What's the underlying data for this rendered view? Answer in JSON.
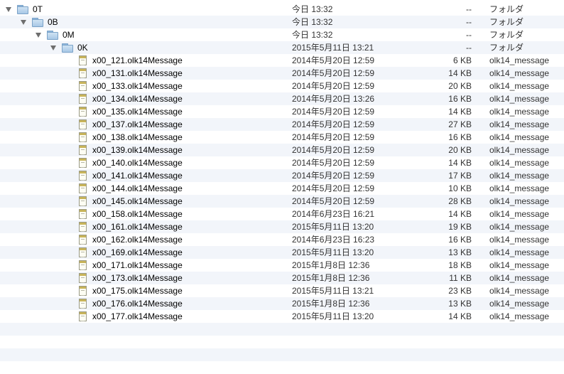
{
  "folders": [
    {
      "name": "0T",
      "date": "今日 13:32",
      "size": "--",
      "kind": "フォルダ"
    },
    {
      "name": "0B",
      "date": "今日 13:32",
      "size": "--",
      "kind": "フォルダ"
    },
    {
      "name": "0M",
      "date": "今日 13:32",
      "size": "--",
      "kind": "フォルダ"
    },
    {
      "name": "0K",
      "date": "2015年5月11日 13:21",
      "size": "--",
      "kind": "フォルダ"
    }
  ],
  "files": [
    {
      "name": "x00_121.olk14Message",
      "date": "2014年5月20日 12:59",
      "size": "6 KB",
      "kind": "olk14_message"
    },
    {
      "name": "x00_131.olk14Message",
      "date": "2014年5月20日 12:59",
      "size": "14 KB",
      "kind": "olk14_message"
    },
    {
      "name": "x00_133.olk14Message",
      "date": "2014年5月20日 12:59",
      "size": "20 KB",
      "kind": "olk14_message"
    },
    {
      "name": "x00_134.olk14Message",
      "date": "2014年5月20日 13:26",
      "size": "16 KB",
      "kind": "olk14_message"
    },
    {
      "name": "x00_135.olk14Message",
      "date": "2014年5月20日 12:59",
      "size": "14 KB",
      "kind": "olk14_message"
    },
    {
      "name": "x00_137.olk14Message",
      "date": "2014年5月20日 12:59",
      "size": "27 KB",
      "kind": "olk14_message"
    },
    {
      "name": "x00_138.olk14Message",
      "date": "2014年5月20日 12:59",
      "size": "16 KB",
      "kind": "olk14_message"
    },
    {
      "name": "x00_139.olk14Message",
      "date": "2014年5月20日 12:59",
      "size": "20 KB",
      "kind": "olk14_message"
    },
    {
      "name": "x00_140.olk14Message",
      "date": "2014年5月20日 12:59",
      "size": "14 KB",
      "kind": "olk14_message"
    },
    {
      "name": "x00_141.olk14Message",
      "date": "2014年5月20日 12:59",
      "size": "17 KB",
      "kind": "olk14_message"
    },
    {
      "name": "x00_144.olk14Message",
      "date": "2014年5月20日 12:59",
      "size": "10 KB",
      "kind": "olk14_message"
    },
    {
      "name": "x00_145.olk14Message",
      "date": "2014年5月20日 12:59",
      "size": "28 KB",
      "kind": "olk14_message"
    },
    {
      "name": "x00_158.olk14Message",
      "date": "2014年6月23日 16:21",
      "size": "14 KB",
      "kind": "olk14_message"
    },
    {
      "name": "x00_161.olk14Message",
      "date": "2015年5月11日 13:20",
      "size": "19 KB",
      "kind": "olk14_message"
    },
    {
      "name": "x00_162.olk14Message",
      "date": "2014年6月23日 16:23",
      "size": "16 KB",
      "kind": "olk14_message"
    },
    {
      "name": "x00_169.olk14Message",
      "date": "2015年5月11日 13:20",
      "size": "13 KB",
      "kind": "olk14_message"
    },
    {
      "name": "x00_171.olk14Message",
      "date": "2015年1月8日 12:36",
      "size": "18 KB",
      "kind": "olk14_message"
    },
    {
      "name": "x00_173.olk14Message",
      "date": "2015年1月8日 12:36",
      "size": "11 KB",
      "kind": "olk14_message"
    },
    {
      "name": "x00_175.olk14Message",
      "date": "2015年5月11日 13:21",
      "size": "23 KB",
      "kind": "olk14_message"
    },
    {
      "name": "x00_176.olk14Message",
      "date": "2015年1月8日 12:36",
      "size": "13 KB",
      "kind": "olk14_message"
    },
    {
      "name": "x00_177.olk14Message",
      "date": "2015年5月11日 13:20",
      "size": "14 KB",
      "kind": "olk14_message"
    }
  ],
  "icons": {
    "disclosure": "disclosure-triangle-down-icon",
    "folder": "folder-icon",
    "file": "document-icon"
  },
  "colors": {
    "stripe": "#f2f5fa",
    "folder": "#a8c8e6",
    "text_secondary": "#333333"
  }
}
